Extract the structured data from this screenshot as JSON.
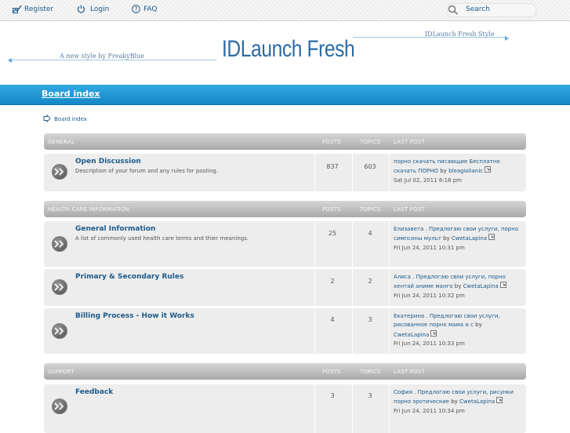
{
  "header": {
    "register_label": "Register",
    "login_label": "Login",
    "faq_label": "FAQ",
    "search_placeholder": "Search",
    "tagline_left": "A new style by FreakyBlue",
    "tagline_right": "IDLaunch Fresh Style",
    "logo_text": "IDLaunch Fresh"
  },
  "nav": {
    "board_index": "Board index"
  },
  "breadcrumb": {
    "label": "Board index"
  },
  "column_labels": {
    "posts": "POSTS",
    "topics": "TOPICS",
    "last_post": "LAST POST"
  },
  "categories": [
    {
      "name": "GENERAL",
      "forums": [
        {
          "title": "Open Discussion",
          "description": "Description of your forum and any rules for posting.",
          "posts": "837",
          "topics": "603",
          "last_post": {
            "subject": "порно скачать писающие Бесплатно скачать ПОРНО",
            "by": "by",
            "user": "bleagiolianic",
            "date": "Sat Jul 02, 2011 8:18 pm"
          }
        }
      ]
    },
    {
      "name": "HEALTH CARE INFORMATION",
      "forums": [
        {
          "title": "General Information",
          "description": "A list of commonly used health care terms and thier meanings.",
          "posts": "25",
          "topics": "4",
          "last_post": {
            "subject": "Елизавета . Предлогаю свои услуги, порно симпсоны мульт",
            "by": "by",
            "user": "CwetaLapina",
            "date": "Fri Jun 24, 2011 10:31 pm"
          }
        },
        {
          "title": "Primary & Secondary Rules",
          "description": "",
          "posts": "2",
          "topics": "2",
          "last_post": {
            "subject": "Алиса . Предлогаю свои услуги, порно хентай аниме манго",
            "by": "by",
            "user": "CwetaLapina",
            "date": "Fri Jun 24, 2011 10:32 pm"
          }
        },
        {
          "title": "Billing Process - How it Works",
          "description": "",
          "posts": "4",
          "topics": "3",
          "last_post": {
            "subject": "Екатерина . Предлогаю свои услуги, рисованное порно мама и с",
            "by": "by",
            "user": "CwetaLapina",
            "date": "Fri Jun 24, 2011 10:33 pm"
          }
        }
      ]
    },
    {
      "name": "SUPPORT",
      "forums": [
        {
          "title": "Feedback",
          "description": "",
          "posts": "3",
          "topics": "3",
          "last_post": {
            "subject": "София . Предлогаю свои услуги, рисунки порно эротические",
            "by": "by",
            "user": "CwetaLapina",
            "date": "Fri Jun 24, 2011 10:34 pm"
          }
        }
      ]
    }
  ],
  "colors": {
    "link": "#1d5a8a",
    "navbar": "#1a93d3",
    "category_header": "#b5b5b5",
    "row_bg": "#ededed"
  }
}
